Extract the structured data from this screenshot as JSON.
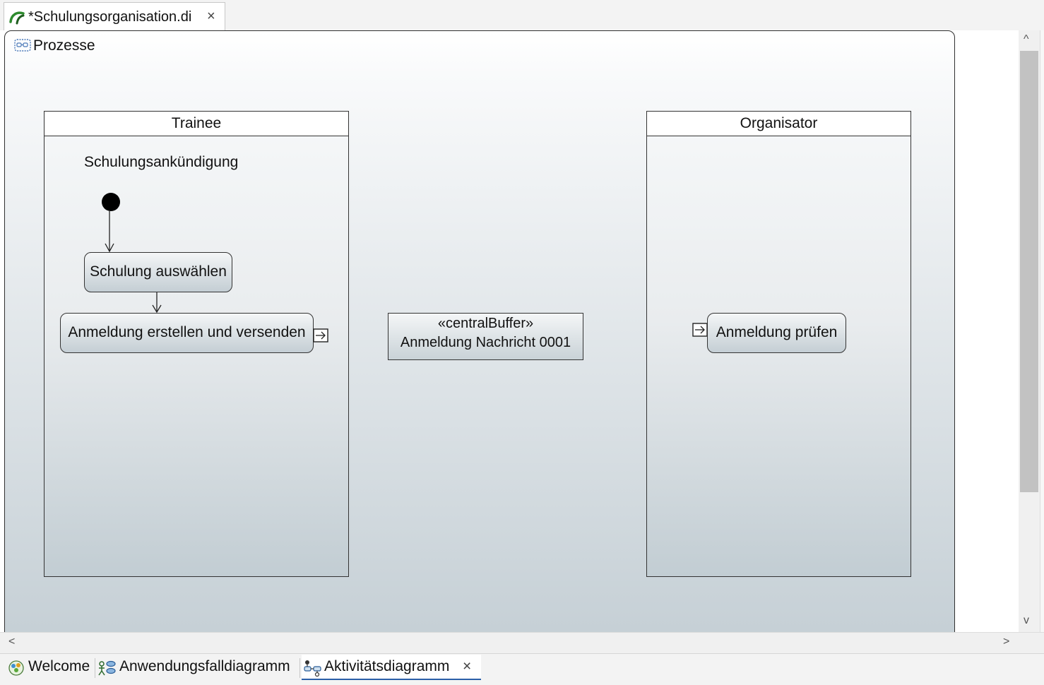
{
  "editor_tab": {
    "title": "*Schulungsorganisation.di",
    "close": "×"
  },
  "diagram": {
    "frame_title": "Prozesse",
    "partitions": [
      {
        "name": "Trainee"
      },
      {
        "name": "Organisator"
      }
    ],
    "trainee_label": "Schulungsankündigung",
    "actions": {
      "select_training": "Schulung auswählen",
      "create_send": "Anmeldung erstellen und versenden",
      "check_registration": "Anmeldung prüfen"
    },
    "central_buffer": {
      "stereotype": "«centralBuffer»",
      "name": "Anmeldung Nachricht 0001"
    }
  },
  "scrollbars": {
    "up": "^",
    "down": "v",
    "left": "<",
    "right": ">"
  },
  "bottom_tabs": [
    {
      "label": "Welcome",
      "icon": "welcome-icon"
    },
    {
      "label": "Anwendungsfalldiagramm",
      "icon": "use-case-diagram-icon"
    },
    {
      "label": "Aktivitätsdiagramm",
      "icon": "activity-diagram-icon",
      "active": true,
      "close": "×"
    }
  ],
  "colors": {
    "active_tab_underline": "#2b5fa8",
    "node_gradient_top": "#f4f6f7",
    "node_gradient_bottom": "#c4ced4"
  }
}
